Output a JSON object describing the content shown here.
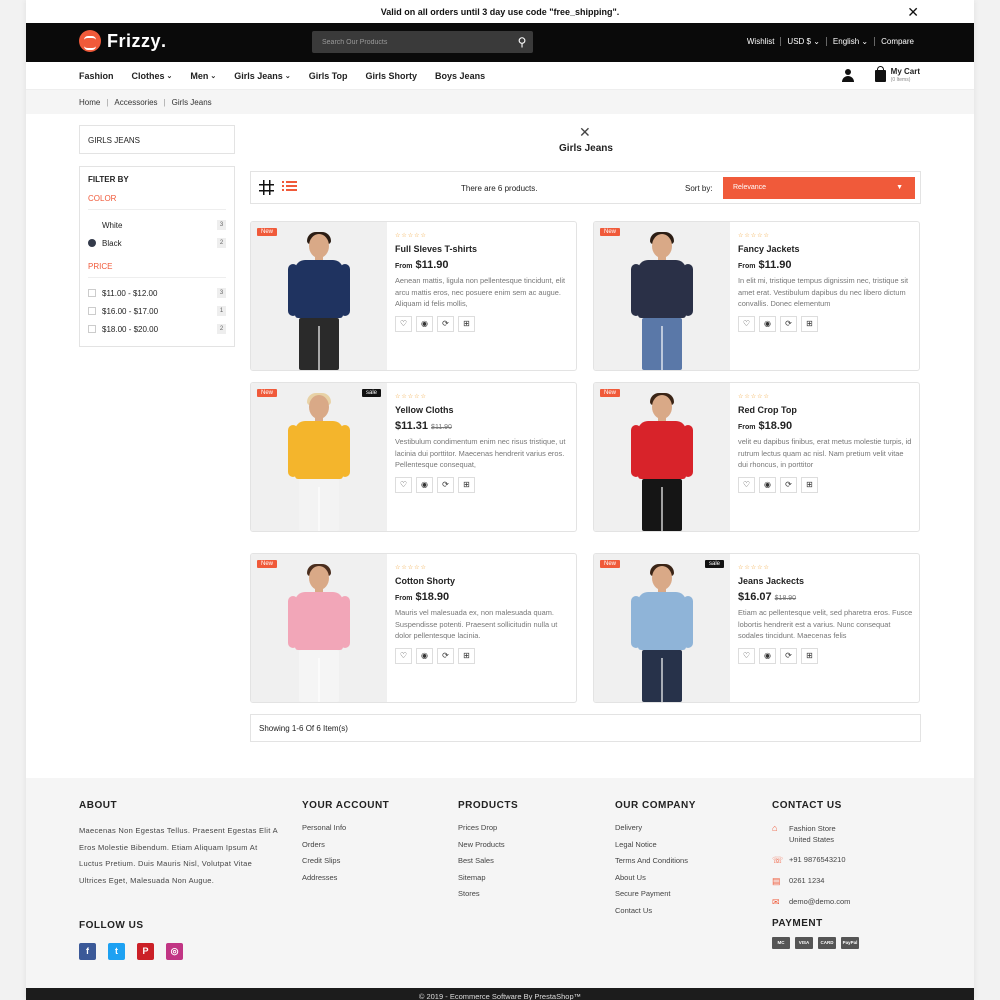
{
  "promo": {
    "text": "Valid on all orders until 3 day use code \"free_shipping\"."
  },
  "header": {
    "brand": "Frizzy",
    "brand_dot": ".",
    "search_placeholder": "Search Our Products",
    "links": [
      "Wishlist",
      "USD $ ⌄",
      "English ⌄",
      "Compare"
    ]
  },
  "nav": {
    "items": [
      {
        "label": "Fashion",
        "chev": ""
      },
      {
        "label": "Clothes",
        "chev": "⌄"
      },
      {
        "label": "Men",
        "chev": "⌄"
      },
      {
        "label": "Girls Jeans",
        "chev": "⌄"
      },
      {
        "label": "Girls Top",
        "chev": ""
      },
      {
        "label": "Girls Shorty",
        "chev": ""
      },
      {
        "label": "Boys Jeans",
        "chev": ""
      }
    ],
    "cart_label": "My Cart",
    "cart_items": "(0 Items)"
  },
  "breadcrumb": [
    "Home",
    "Accessories",
    "Girls Jeans"
  ],
  "sidebar": {
    "category": "GIRLS JEANS",
    "filter_title": "FILTER BY",
    "color_heading": "COLOR",
    "colors": [
      {
        "label": "White",
        "count": "3",
        "swatch": "#ffffff"
      },
      {
        "label": "Black",
        "count": "2",
        "swatch": "#333a4a"
      }
    ],
    "price_heading": "PRICE",
    "prices": [
      {
        "label": "$11.00 - $12.00",
        "count": "3"
      },
      {
        "label": "$16.00 - $17.00",
        "count": "1"
      },
      {
        "label": "$18.00 - $20.00",
        "count": "2"
      }
    ]
  },
  "main": {
    "title": "Girls Jeans",
    "count_text": "There are 6 products.",
    "sort_label": "Sort by:",
    "sort_value": "Relevance",
    "pager_text": "Showing 1-6 Of 6 Item(s)"
  },
  "products": [
    {
      "name": "Full Sleves T-shirts",
      "prefix": "From",
      "price": "$11.90",
      "old": "",
      "new": "New",
      "sale": "",
      "desc": "Aenean mattis, ligula non pellentesque tincidunt, elit arcu mattis eros, nec posuere enim sem ac augue. Aliquam id felis mollis,",
      "colors": {
        "top": "#1f3360",
        "bottom": "#2a2a2a",
        "hair": "#2b1d14"
      }
    },
    {
      "name": "Fancy Jackets",
      "prefix": "From",
      "price": "$11.90",
      "old": "",
      "new": "New",
      "sale": "",
      "desc": "In elit mi, tristique tempus dignissim nec, tristique sit amet erat. Vestibulum dapibus du nec libero dictum convallis. Donec elementum",
      "colors": {
        "top": "#2a3047",
        "bottom": "#5a78a8",
        "hair": "#2b1d14"
      }
    },
    {
      "name": "Yellow Cloths",
      "prefix": "",
      "price": "$11.31",
      "old": "$11.90",
      "new": "New",
      "sale": "sale",
      "desc": "Vestibulum condimentum enim nec risus tristique, ut lacinia dui porttitor. Maecenas hendrerit varius eros. Pellentesque consequat,",
      "colors": {
        "top": "#f4b52c",
        "bottom": "#f3f3f3",
        "hair": "#e8d2a6"
      }
    },
    {
      "name": "Red Crop Top",
      "prefix": "From",
      "price": "$18.90",
      "old": "",
      "new": "New",
      "sale": "",
      "desc": "velit eu dapibus finibus, erat metus molestie turpis, id rutrum lectus quam ac nisl. Nam pretium velit vitae dui rhoncus, in porttitor",
      "colors": {
        "top": "#d8232a",
        "bottom": "#151515",
        "hair": "#3a2416"
      }
    },
    {
      "name": "Cotton Shorty",
      "prefix": "From",
      "price": "$18.90",
      "old": "",
      "new": "New",
      "sale": "",
      "desc": "Mauris vel malesuada ex, non malesuada quam. Suspendisse potenti. Praesent sollicitudin nulla ut dolor pellentesque lacinia.",
      "colors": {
        "top": "#f2a6b8",
        "bottom": "#f5f5f5",
        "hair": "#4a2e1e"
      }
    },
    {
      "name": "Jeans Jackects",
      "prefix": "",
      "price": "$16.07",
      "old": "$18.90",
      "new": "New",
      "sale": "sale",
      "desc": "Etiam ac pellentesque velit, sed pharetra eros. Fusce lobortis hendrerit est a varius. Nunc consequat sodales tincidunt. Maecenas felis",
      "colors": {
        "top": "#8fb4d8",
        "bottom": "#27324a",
        "hair": "#3a2416"
      }
    }
  ],
  "footer": {
    "about_title": "ABOUT",
    "about_text": "Maecenas Non Egestas Tellus. Praesent Egestas Elit A Eros Molestie Bibendum. Etiam Aliquam Ipsum At Luctus Pretium. Duis Mauris Nisl, Volutpat Vitae Ultrices Eget, Malesuada Non Augue.",
    "follow_title": "FOLLOW US",
    "account_title": "YOUR ACCOUNT",
    "account_links": [
      "Personal Info",
      "Orders",
      "Credit Slips",
      "Addresses"
    ],
    "products_title": "PRODUCTS",
    "products_links": [
      "Prices Drop",
      "New Products",
      "Best Sales",
      "Sitemap",
      "Stores"
    ],
    "company_title": "OUR COMPANY",
    "company_links": [
      "Delivery",
      "Legal Notice",
      "Terms And Conditions",
      "About Us",
      "Secure Payment",
      "Contact Us"
    ],
    "contact_title": "CONTACT US",
    "contact_address": "Fashion Store United States",
    "contact_phone": "+91 9876543210",
    "contact_fax": "0261 1234",
    "contact_email": "demo@demo.com",
    "payment_title": "PAYMENT",
    "payment_methods": [
      "MC",
      "VISA",
      "CARD",
      "PayPal"
    ],
    "copyright": "© 2019 - Ecommerce Software By PrestaShop™"
  },
  "theme": {
    "accent": "#f05a3a",
    "dark": "#0a0a0a"
  },
  "icons": {
    "social": [
      {
        "name": "facebook-icon",
        "glyph": "f",
        "color": "#3b5998"
      },
      {
        "name": "twitter-icon",
        "glyph": "t",
        "color": "#1da1f2"
      },
      {
        "name": "pinterest-icon",
        "glyph": "P",
        "color": "#cb2027"
      },
      {
        "name": "instagram-icon",
        "glyph": "◎",
        "color": "#c13584"
      }
    ]
  }
}
